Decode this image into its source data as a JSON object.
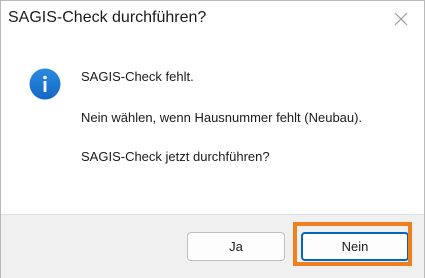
{
  "dialog": {
    "title": "SAGIS-Check durchführen?",
    "close_icon": "close-icon",
    "message_icon": "info-icon",
    "messages": [
      "SAGIS-Check fehlt.",
      "Nein wählen, wenn Hausnummer fehlt (Neubau).",
      "SAGIS-Check jetzt durchführen?"
    ],
    "buttons": {
      "yes_label": "Ja",
      "no_label": "Nein"
    },
    "colors": {
      "info_icon": "#1e7fd6",
      "highlight": "#f0801e",
      "focus_border": "#0067c0",
      "footer_bg": "#f0f0f0"
    }
  }
}
